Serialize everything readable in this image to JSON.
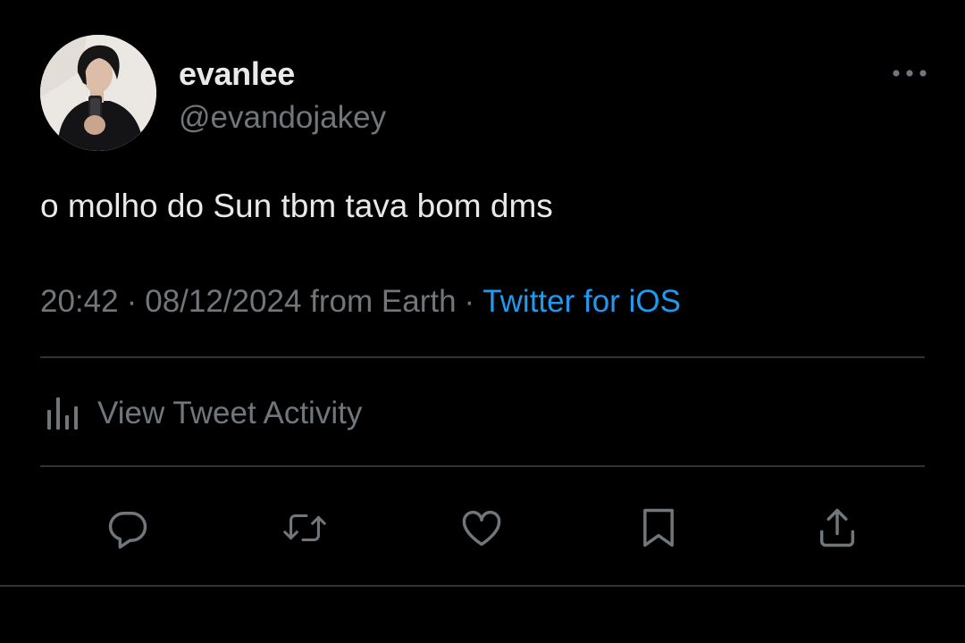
{
  "author": {
    "display_name": "evanlee",
    "handle": "@evandojakey"
  },
  "tweet": {
    "text": "o molho do Sun tbm tava bom dms",
    "time": "20:42",
    "date": "08/12/2024",
    "location": "from Earth",
    "separator": "·",
    "source": "Twitter for iOS"
  },
  "activity": {
    "label": "View Tweet Activity"
  },
  "icons": {
    "more": "more-options-icon",
    "activity": "bar-chart-icon",
    "reply": "reply-icon",
    "retweet": "retweet-icon",
    "like": "heart-icon",
    "bookmark": "bookmark-icon",
    "share": "share-icon"
  },
  "colors": {
    "background": "#000000",
    "text_primary": "#e7e9ea",
    "text_secondary": "#71767b",
    "link": "#1d9bf0",
    "divider": "#2f3336"
  }
}
